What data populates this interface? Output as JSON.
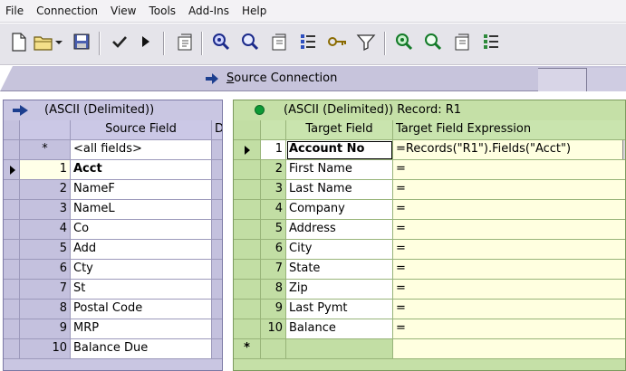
{
  "menu": {
    "items": [
      "File",
      "Connection",
      "View",
      "Tools",
      "Add-Ins",
      "Help"
    ]
  },
  "toolbar": {
    "icons": [
      "new-document-icon",
      "open-folder-icon",
      "dropdown-arrow-icon",
      "save-icon",
      "check-icon",
      "run-icon",
      "properties-icon",
      "zoom-icon",
      "find-icon",
      "properties-icon",
      "list-icon",
      "key-icon",
      "filter-icon",
      "zoom-icon",
      "find-icon",
      "properties-icon",
      "list-icon"
    ]
  },
  "connection_bar": {
    "label": "Source Connection",
    "accesskey": "S"
  },
  "source": {
    "title": "(ASCII (Delimited))",
    "column_header": "Source Field",
    "next_column_header_fragment": "D",
    "rows": [
      {
        "num": "*",
        "field": "<all fields>"
      },
      {
        "num": "1",
        "field": "Acct"
      },
      {
        "num": "2",
        "field": "NameF"
      },
      {
        "num": "3",
        "field": "NameL"
      },
      {
        "num": "4",
        "field": "Co"
      },
      {
        "num": "5",
        "field": "Add"
      },
      {
        "num": "6",
        "field": "Cty"
      },
      {
        "num": "7",
        "field": "St"
      },
      {
        "num": "8",
        "field": "Postal Code"
      },
      {
        "num": "9",
        "field": "MRP"
      },
      {
        "num": "10",
        "field": "Balance Due"
      }
    ]
  },
  "target": {
    "title": "(ASCII (Delimited)) Record: R1",
    "column_header_field": "Target Field",
    "column_header_expr": "Target Field Expression",
    "rows": [
      {
        "num": "1",
        "field": "Account No",
        "expr": "=Records(\"R1\").Fields(\"Acct\")"
      },
      {
        "num": "2",
        "field": "First Name",
        "expr": "="
      },
      {
        "num": "3",
        "field": "Last Name",
        "expr": "="
      },
      {
        "num": "4",
        "field": "Company",
        "expr": "="
      },
      {
        "num": "5",
        "field": "Address",
        "expr": "="
      },
      {
        "num": "6",
        "field": "City",
        "expr": "="
      },
      {
        "num": "7",
        "field": "State",
        "expr": "="
      },
      {
        "num": "8",
        "field": "Zip",
        "expr": "="
      },
      {
        "num": "9",
        "field": "Last Pymt",
        "expr": "="
      },
      {
        "num": "10",
        "field": "Balance",
        "expr": "="
      }
    ],
    "new_row_marker": "*",
    "ellipsis": "..."
  }
}
